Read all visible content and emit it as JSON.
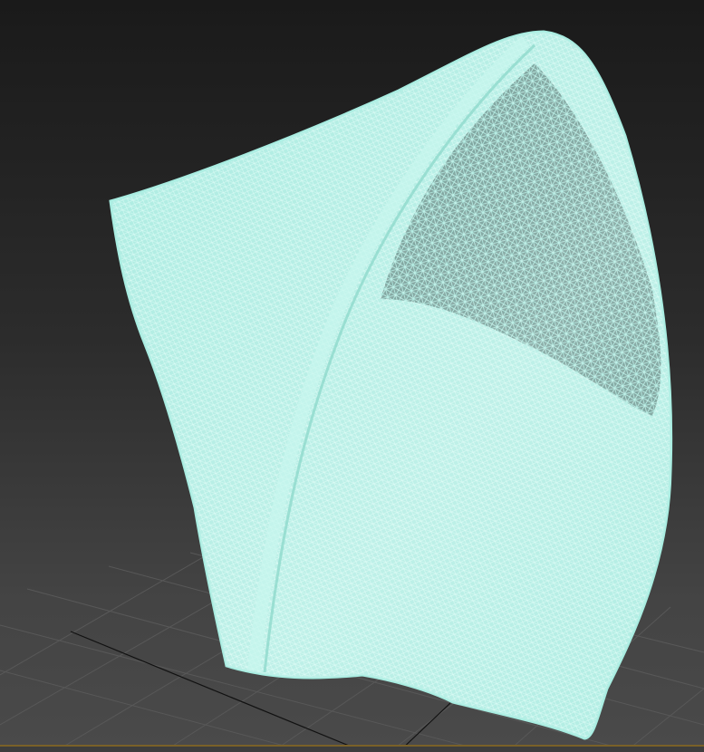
{
  "viewport": {
    "active_border_color": "#7a6128",
    "mesh_color": "#a6ece0",
    "grid_color": "#5a5a5a",
    "axis_color": "#111111",
    "display_mode": "wireframe-over-shaded"
  }
}
